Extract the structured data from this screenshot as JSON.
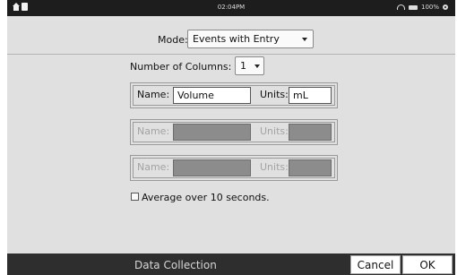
{
  "status_bar": {
    "time": "02:04PM",
    "battery": "100%",
    "icons": [
      "home-icon",
      "document-icon",
      "wifi-icon",
      "battery-icon",
      "gear-icon"
    ]
  },
  "mode": {
    "label": "Mode:",
    "value": "Events with Entry"
  },
  "columns": {
    "label": "Number of Columns:",
    "value": "1"
  },
  "columns_list": [
    {
      "name_label": "Name:",
      "name_value": "Volume",
      "units_label": "Units:",
      "units_value": "mL",
      "enabled": true
    },
    {
      "name_label": "Name:",
      "name_value": "",
      "units_label": "Units:",
      "units_value": "",
      "enabled": false
    },
    {
      "name_label": "Name:",
      "name_value": "",
      "units_label": "Units:",
      "units_value": "",
      "enabled": false
    }
  ],
  "average": {
    "label": "Average over 10 seconds.",
    "checked": false
  },
  "bottom_bar": {
    "title": "Data Collection",
    "cancel_label": "Cancel",
    "ok_label": "OK"
  }
}
